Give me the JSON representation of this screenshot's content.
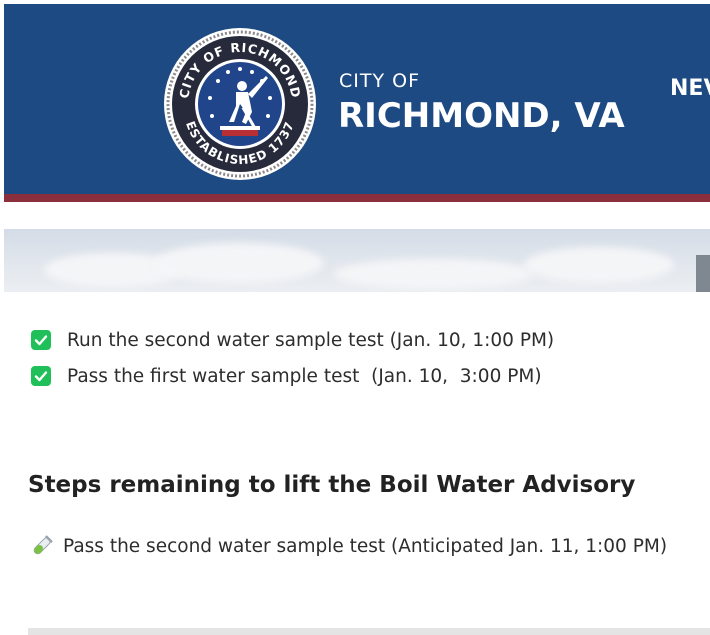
{
  "header": {
    "seal_text_top": "CITY OF RICHMOND",
    "seal_text_bottom": "ESTABLISHED 1737",
    "brand_pre": "CITY OF",
    "brand_main": "RICHMOND, VA",
    "nav_partial": "NEV",
    "colors": {
      "background": "#1d4a82",
      "stripe": "#8c2f3c"
    }
  },
  "completed_steps": [
    {
      "label": "Run the second water sample test (Jan. 10, 1:00 PM)",
      "icon": "check-box-icon"
    },
    {
      "label": "Pass the first water sample test  (Jan. 10,  3:00 PM)",
      "icon": "check-box-icon"
    }
  ],
  "remaining": {
    "heading": "Steps remaining to lift the Boil Water Advisory",
    "items": [
      {
        "label": "Pass the second water sample test (Anticipated Jan. 11, 1:00 PM)",
        "icon": "test-tube-icon"
      }
    ]
  },
  "colors": {
    "check_green": "#1fbf5a"
  }
}
